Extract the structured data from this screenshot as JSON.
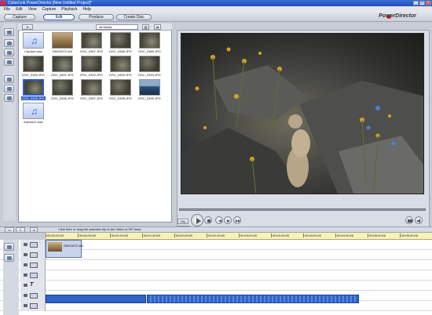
{
  "window": {
    "title": "CyberLink PowerDirector [New Untitled Project]*"
  },
  "menu": [
    "File",
    "Edit",
    "View",
    "Capture",
    "Playback",
    "Help"
  ],
  "modes": {
    "capture": "Capture",
    "edit": "Edit",
    "produce": "Produce",
    "create_disc": "Create Disc"
  },
  "brand": "PowerDirector",
  "library": {
    "filter": "All Media",
    "items": [
      {
        "label": "Capture.wav",
        "kind": "audio"
      },
      {
        "label": "DMG0072.AVI",
        "kind": "video"
      },
      {
        "label": "DSC_0387.JPG",
        "kind": "photo"
      },
      {
        "label": "DSC_0388.JPG",
        "kind": "photo"
      },
      {
        "label": "DSC_0389.JPG",
        "kind": "photo"
      },
      {
        "label": "DSC_0390.JPG",
        "kind": "photo"
      },
      {
        "label": "DSC_0391.JPG",
        "kind": "photo"
      },
      {
        "label": "DSC_0392.JPG",
        "kind": "photo"
      },
      {
        "label": "DSC_0393.JPG",
        "kind": "photo"
      },
      {
        "label": "DSC_0394.JPG",
        "kind": "photo"
      },
      {
        "label": "DSC_0395.JPG",
        "kind": "photo",
        "selected": true
      },
      {
        "label": "DSC_0396.JPG",
        "kind": "photo"
      },
      {
        "label": "DSC_0397.JPG",
        "kind": "photo"
      },
      {
        "label": "DSC_0398.JPG",
        "kind": "photo"
      },
      {
        "label": "DSC_0399.JPG",
        "kind": "lake"
      },
      {
        "label": "mybono1.wav",
        "kind": "audio"
      }
    ]
  },
  "preview": {
    "clip_label": "Clip",
    "movie_label": "Movie"
  },
  "timeline": {
    "hint": "Click here or drag the selected clip to the Video or PiP track",
    "ruler": [
      "00;00;00;00",
      "00;00;30;00",
      "00;01;00;00",
      "00;01;30;00",
      "00;02;00;00",
      "00;02;30;00",
      "00;03;00;00",
      "00;03;30;00",
      "00;04;00;00",
      "00;04;30;00",
      "00;05;00;00",
      "00;05;30;00"
    ],
    "video_clip": "DMG0072.AVI"
  }
}
